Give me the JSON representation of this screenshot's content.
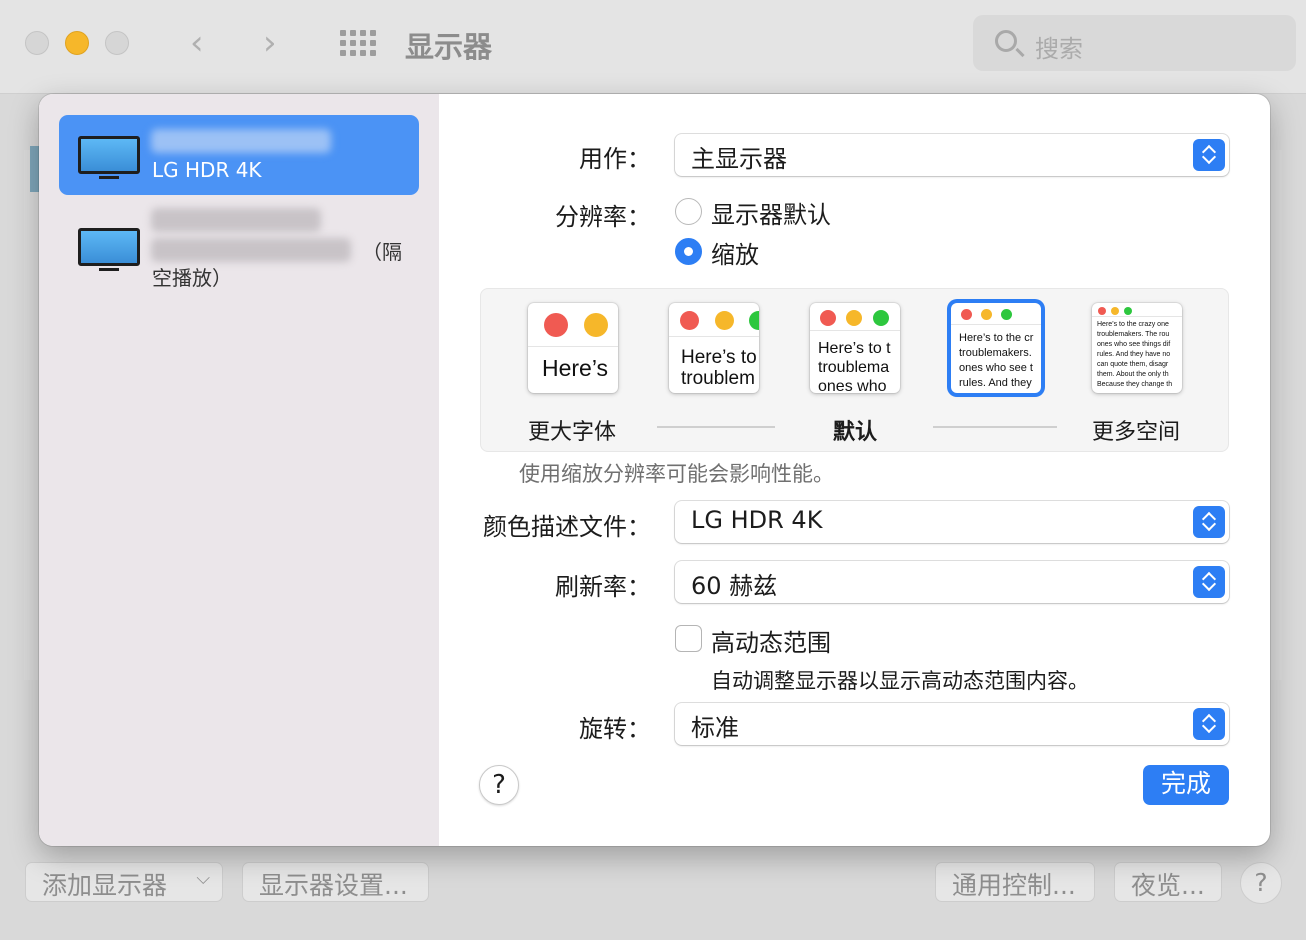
{
  "window": {
    "title": "显示器",
    "search_placeholder": "搜索"
  },
  "displays": [
    {
      "name": "LG HDR 4K",
      "selected": true
    },
    {
      "suffix_line1": "（隔",
      "suffix_line2": "空播放）",
      "selected": false
    }
  ],
  "settings": {
    "use_as_label": "用作：",
    "use_as_value": "主显示器",
    "resolution_label": "分辨率：",
    "resolution_options": [
      "显示器默认",
      "缩放"
    ],
    "resolution_selected": "缩放",
    "scale_options": [
      {
        "preview": "Here’s"
      },
      {
        "preview": "Here’s to\ntroublem"
      },
      {
        "preview": "Here’s to t\ntroublema\nones who"
      },
      {
        "preview": "Here’s to the cr\ntroublemakers.\nones who see t\nrules. And they"
      },
      {
        "preview": "Here’s to the crazy one\ntroublemakers. The rou\nones who see things dif\nrules. And they have no\ncan quote them, disagr\nthem. About the only th\nBecause they change th"
      }
    ],
    "scale_selected_index": 3,
    "scale_label_left": "更大字体",
    "scale_label_default": "默认",
    "scale_label_right": "更多空间",
    "scale_hint": "使用缩放分辨率可能会影响性能。",
    "color_profile_label": "颜色描述文件：",
    "color_profile_value": "LG HDR 4K",
    "refresh_label": "刷新率：",
    "refresh_value": "60 赫兹",
    "hdr_label": "高动态范围",
    "hdr_checked": false,
    "hdr_hint": "自动调整显示器以显示高动态范围内容。",
    "rotation_label": "旋转：",
    "rotation_value": "标准",
    "help_label": "?",
    "done_label": "完成"
  },
  "bottom_bar": {
    "add_display": "添加显示器",
    "display_settings": "显示器设置...",
    "universal_control": "通用控制...",
    "night_shift": "夜览...",
    "help": "?"
  },
  "colors": {
    "accent": "#2d7ef4",
    "sidebar_selected": "#4b93f5",
    "traffic_minimize": "#f6b72a"
  }
}
